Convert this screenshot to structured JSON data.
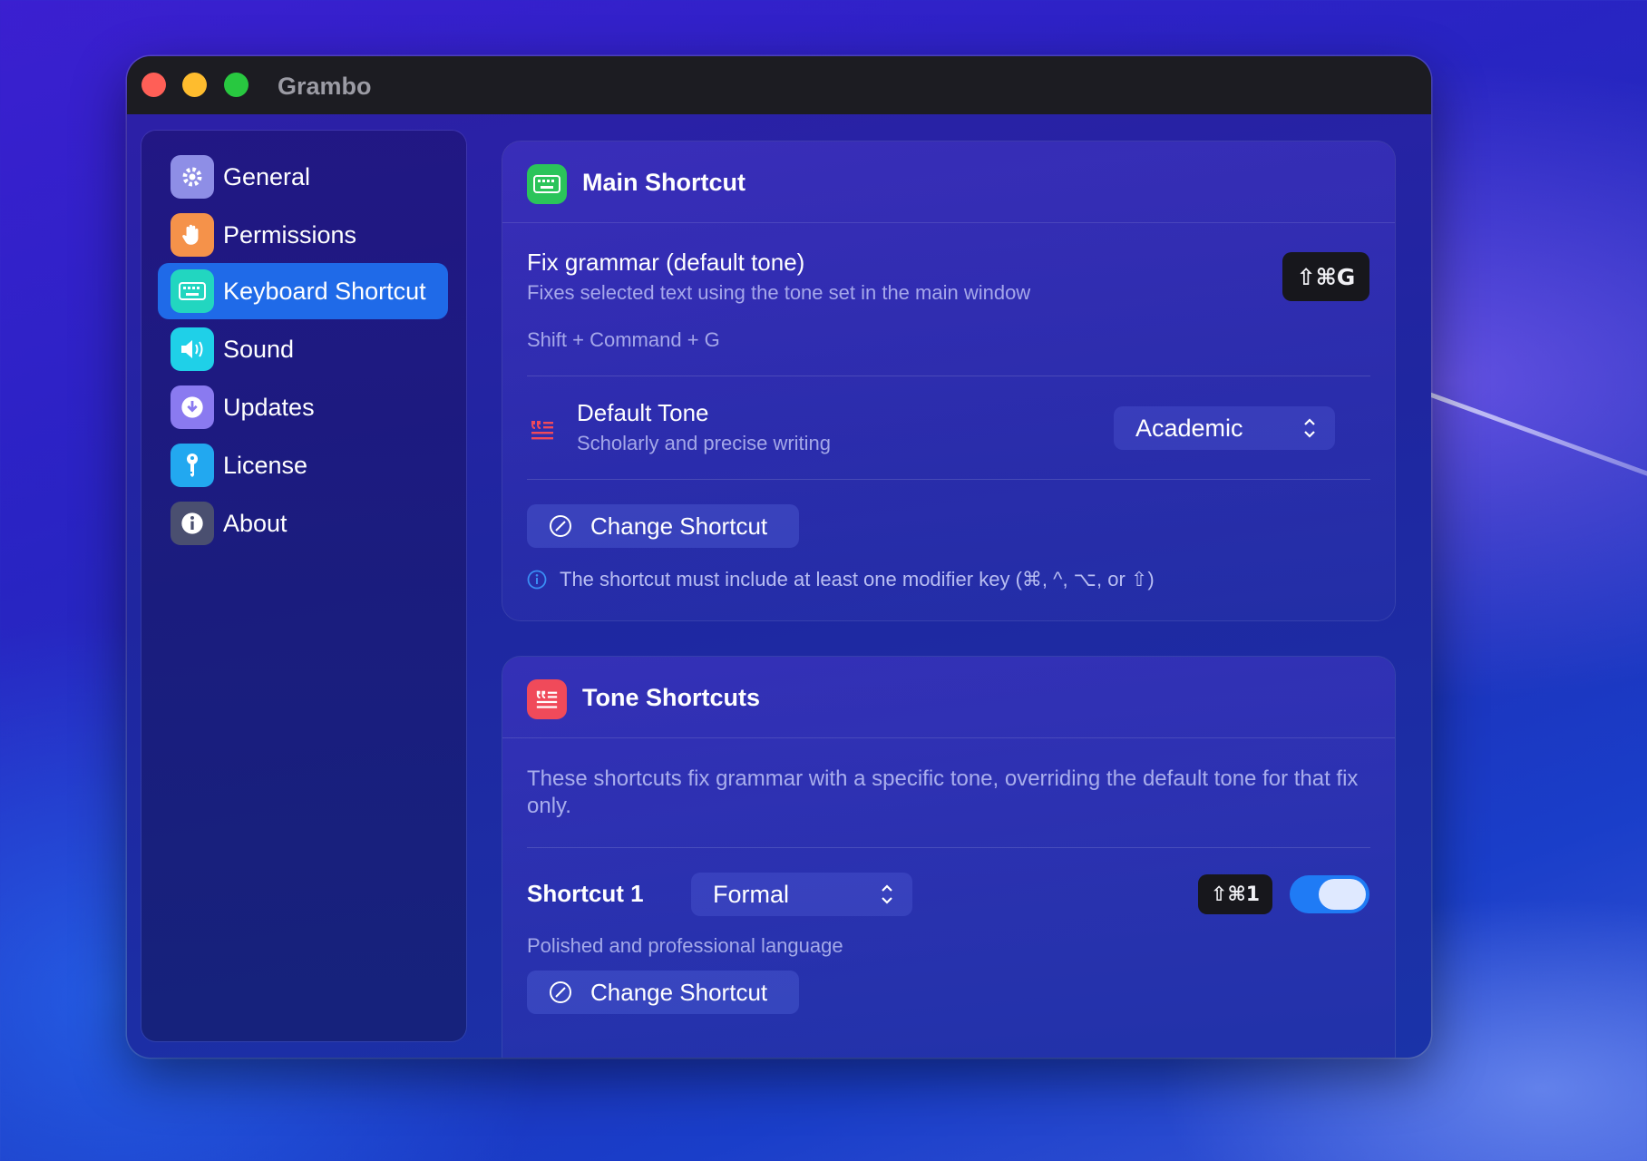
{
  "window": {
    "title": "Grambo"
  },
  "sidebar": {
    "items": [
      {
        "label": "General",
        "icon": "gear-icon",
        "color": "#8e8ee6",
        "active": false
      },
      {
        "label": "Permissions",
        "icon": "hand-icon",
        "color": "#f5924a",
        "active": false
      },
      {
        "label": "Keyboard Shortcut",
        "icon": "keyboard-icon",
        "color": "#22d6c0",
        "active": true
      },
      {
        "label": "Sound",
        "icon": "speaker-icon",
        "color": "#1fd0e8",
        "active": false
      },
      {
        "label": "Updates",
        "icon": "download-icon",
        "color": "#8a7af0",
        "active": false
      },
      {
        "label": "License",
        "icon": "key-icon",
        "color": "#22a8f0",
        "active": false
      },
      {
        "label": "About",
        "icon": "info-icon",
        "color": "#4a4f70",
        "active": false
      }
    ]
  },
  "main_shortcut": {
    "title": "Main Shortcut",
    "icon_color": "#2bc45a",
    "fix_title": "Fix grammar (default tone)",
    "fix_subtitle": "Fixes selected text using the tone set in the main window",
    "keycap": "⇧⌘G",
    "shortcut_text": "Shift + Command + G",
    "default_tone_title": "Default Tone",
    "default_tone_subtitle": "Scholarly and precise writing",
    "default_tone_value": "Academic",
    "change_button": "Change Shortcut",
    "info_text": "The shortcut must include at least one modifier key (⌘, ^, ⌥, or ⇧)"
  },
  "tone_shortcuts": {
    "title": "Tone Shortcuts",
    "icon_color": "#f04a5a",
    "description": "These shortcuts fix grammar with a specific tone, overriding the default tone for that fix only.",
    "shortcut1": {
      "label": "Shortcut 1",
      "tone": "Formal",
      "keycap": "⇧⌘1",
      "enabled": true,
      "subtitle": "Polished and professional language",
      "change_button": "Change Shortcut"
    }
  }
}
